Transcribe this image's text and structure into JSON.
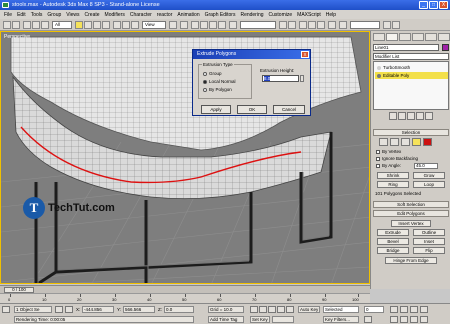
{
  "window": {
    "title": "stoolx.max - Autodesk 3ds Max 8 SP3 - Stand-alone License",
    "buttons": [
      "_",
      "□",
      "X"
    ]
  },
  "menu": [
    "File",
    "Edit",
    "Tools",
    "Group",
    "Views",
    "Create",
    "Modifiers",
    "Character",
    "reactor",
    "Animation",
    "Graph Editors",
    "Rendering",
    "Customize",
    "MAXScript",
    "Help"
  ],
  "toolbar": {
    "selection_filter": "All",
    "reference_coord": "View"
  },
  "viewport": {
    "label": "Perspective",
    "logo_text": "TechTut.com",
    "logo_mark": "T"
  },
  "dialog": {
    "title": "Extrude Polygons",
    "close": "X",
    "extrusion_type_label": "Extrusion Type",
    "options": [
      "Group",
      "Local Normal",
      "By Polygon"
    ],
    "selected_option": "Local Normal",
    "height_label": "Extrusion Height:",
    "height_value": "8.0",
    "apply": "Apply",
    "ok": "OK",
    "cancel": "Cancel"
  },
  "command_panel": {
    "object_name": "Line01",
    "object_color": "#a021a8",
    "modifier_list": "Modifier List",
    "stack": [
      "TurboSmooth",
      "Editable Poly"
    ],
    "selected_stack_item": "Editable Poly",
    "selection_rollout": "Selection",
    "by_vertex": "By Vertex",
    "ignore_backfacing": "Ignore Backfacing",
    "by_angle": "By Angle:",
    "angle_value": "45.0",
    "shrink": "Shrink",
    "grow": "Grow",
    "ring": "Ring",
    "loop": "Loop",
    "selection_info": "101 Polygons Selected",
    "soft_selection": "Soft Selection",
    "edit_polygons": "Edit Polygons",
    "insert_vertex": "Insert Vertex",
    "extrude": "Extrude",
    "outline": "Outline",
    "bevel": "Bevel",
    "inset": "Inset",
    "bridge": "Bridge",
    "flip": "Flip",
    "hinge": "Hinge From Edge"
  },
  "timeline": {
    "frame_display": "0 / 100",
    "ticks": [
      "0",
      "10",
      "20",
      "30",
      "40",
      "50",
      "60",
      "70",
      "80",
      "90",
      "100"
    ]
  },
  "status": {
    "object_count": "1 Object Se",
    "x_label": "X:",
    "x_value": "-444.856",
    "y_label": "Y:",
    "y_value": "566.566",
    "z_label": "Z:",
    "z_value": "0.0",
    "grid": "Grid = 10.0",
    "rendering_time": "Rendering Time: 0:00:05",
    "add_time_tag": "Add Time Tag",
    "auto_key": "Auto Key",
    "set_key": "Set Key",
    "selected": "Selected",
    "key_filters": "Key Filters...",
    "frame": "0"
  }
}
